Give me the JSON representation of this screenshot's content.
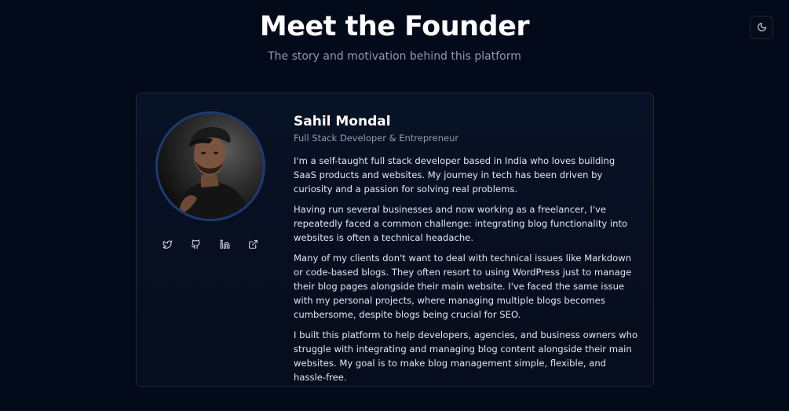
{
  "header": {
    "title": "Meet the Founder",
    "subtitle": "The story and motivation behind this platform"
  },
  "theme_toggle": {
    "icon": "moon-icon"
  },
  "founder": {
    "name": "Sahil Mondal",
    "role": "Full Stack Developer & Entrepreneur",
    "social": [
      {
        "icon": "twitter-icon"
      },
      {
        "icon": "github-icon"
      },
      {
        "icon": "linkedin-icon"
      },
      {
        "icon": "external-link-icon"
      }
    ],
    "bio": [
      "I'm a self-taught full stack developer based in India who loves building SaaS products and websites. My journey in tech has been driven by curiosity and a passion for solving real problems.",
      "Having run several businesses and now working as a freelancer, I've repeatedly faced a common challenge: integrating blog functionality into websites is often a technical headache.",
      "Many of my clients don't want to deal with technical issues like Markdown or code-based blogs. They often resort to using WordPress just to manage their blog pages alongside their main website. I've faced the same issue with my personal projects, where managing multiple blogs becomes cumbersome, despite blogs being crucial for SEO.",
      "I built this platform to help developers, agencies, and business owners who struggle with integrating and managing blog content alongside their main websites. My goal is to make blog management simple, flexible, and hassle-free."
    ]
  },
  "colors": {
    "background": "#030a19",
    "card_border": "#1f2838",
    "avatar_ring": "#1d3a72",
    "muted_text": "#8f9bb0"
  }
}
